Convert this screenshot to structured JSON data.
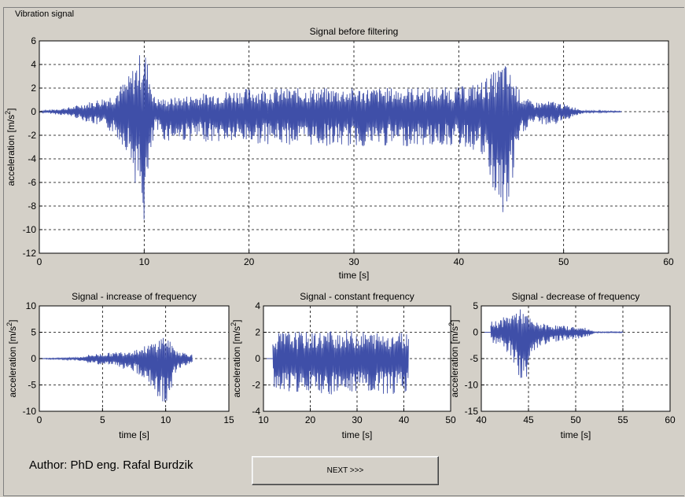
{
  "panel": {
    "title": "Vibration signal"
  },
  "author": "Author: PhD eng. Rafal Burdzik",
  "next_button": "NEXT >>>",
  "colors": {
    "signal": "#3f4fa8",
    "background": "#d4d0c8",
    "axes_bg": "#ffffff"
  },
  "chart_data": [
    {
      "type": "line",
      "title": "Signal before filtering",
      "xlabel": "time [s]",
      "ylabel": "acceleration [m/s2]",
      "xlim": [
        0,
        60
      ],
      "ylim": [
        -12,
        6
      ],
      "xticks": [
        0,
        10,
        20,
        30,
        40,
        50,
        60
      ],
      "yticks": [
        -12,
        -10,
        -8,
        -6,
        -4,
        -2,
        0,
        2,
        4,
        6
      ],
      "grid": true,
      "envelope": {
        "t": [
          0,
          3,
          5,
          7,
          8.5,
          9.5,
          10,
          10.5,
          11,
          12,
          15,
          20,
          30,
          40,
          42,
          43.5,
          44.3,
          45,
          46,
          47,
          49,
          51,
          52,
          55.5
        ],
        "upper": [
          0.05,
          0.4,
          0.9,
          1.5,
          3,
          4.8,
          5.7,
          3.5,
          1.2,
          1.1,
          1.5,
          2.0,
          2.0,
          2.1,
          2.5,
          3.5,
          4.3,
          3.2,
          1.5,
          0.8,
          0.9,
          0.4,
          0.1,
          0.05
        ],
        "lower": [
          -0.05,
          -0.4,
          -1.0,
          -1.8,
          -3.5,
          -7.5,
          -9.8,
          -5.5,
          -1.6,
          -2.5,
          -2.5,
          -2.7,
          -3.0,
          -2.9,
          -3.5,
          -7.5,
          -10.3,
          -7.0,
          -2.0,
          -1.0,
          -1.2,
          -0.4,
          -0.1,
          -0.05
        ]
      }
    },
    {
      "type": "line",
      "title": "Signal - increase of frequency",
      "xlabel": "time [s]",
      "ylabel": "acceleration [m/s2]",
      "xlim": [
        0,
        15
      ],
      "ylim": [
        -10,
        10
      ],
      "xticks": [
        0,
        5,
        10,
        15
      ],
      "yticks": [
        -10,
        -5,
        0,
        5,
        10
      ],
      "grid": true,
      "envelope": {
        "t": [
          0,
          3,
          4,
          6,
          7.5,
          8.5,
          9.3,
          10,
          10.5,
          11,
          11.5,
          12.1
        ],
        "upper": [
          0.05,
          0.2,
          0.8,
          1.2,
          1.8,
          2.5,
          3.5,
          5.0,
          2.5,
          1.5,
          1.2,
          0.8
        ],
        "lower": [
          -0.05,
          -0.3,
          -0.9,
          -1.5,
          -2.5,
          -4.0,
          -7.5,
          -10.0,
          -5.5,
          -2.0,
          -1.5,
          -0.8
        ]
      }
    },
    {
      "type": "line",
      "title": "Signal - constant frequency",
      "xlabel": "time [s]",
      "ylabel": "acceleration [m/s2]",
      "xlim": [
        10,
        50
      ],
      "ylim": [
        -4,
        4
      ],
      "xticks": [
        10,
        20,
        30,
        40,
        50
      ],
      "yticks": [
        -4,
        -2,
        0,
        2,
        4
      ],
      "grid": true,
      "envelope": {
        "t": [
          12,
          13,
          16,
          20,
          25,
          30,
          35,
          40,
          41
        ],
        "upper": [
          1.5,
          2.0,
          2.1,
          2.0,
          2.2,
          2.1,
          2.0,
          2.1,
          2.0
        ],
        "lower": [
          -2.0,
          -2.5,
          -2.6,
          -2.7,
          -2.8,
          -2.7,
          -2.8,
          -2.6,
          -2.4
        ]
      }
    },
    {
      "type": "line",
      "title": "Signal - decrease of frequency",
      "xlabel": "time [s]",
      "ylabel": "acceleration [m/s2]",
      "xlim": [
        40,
        60
      ],
      "ylim": [
        -15,
        5
      ],
      "xticks": [
        40,
        45,
        50,
        55,
        60
      ],
      "yticks": [
        -15,
        -10,
        -5,
        0,
        5
      ],
      "grid": true,
      "envelope": {
        "t": [
          41,
          42,
          43,
          44,
          44.5,
          45.5,
          47,
          49,
          51.2,
          52,
          55
        ],
        "upper": [
          2.0,
          2.5,
          3.5,
          4.5,
          4.0,
          2.0,
          1.5,
          1.2,
          0.8,
          0.1,
          0.1
        ],
        "lower": [
          -2.5,
          -2.5,
          -4.5,
          -9.0,
          -10.5,
          -4.0,
          -2.0,
          -1.5,
          -1.0,
          -0.1,
          -0.1
        ]
      }
    }
  ]
}
